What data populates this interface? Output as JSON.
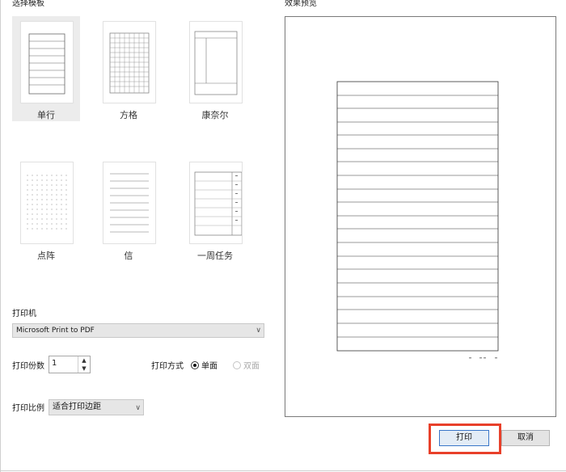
{
  "templates_section": {
    "label": "选择模板"
  },
  "preview_section": {
    "label": "效果预览"
  },
  "templates": [
    {
      "label": "单行",
      "icon": "single-line-icon",
      "selected": true
    },
    {
      "label": "方格",
      "icon": "grid-icon",
      "selected": false
    },
    {
      "label": "康奈尔",
      "icon": "cornell-icon",
      "selected": false
    },
    {
      "label": "点阵",
      "icon": "dot-grid-icon",
      "selected": false
    },
    {
      "label": "信",
      "icon": "letter-lines-icon",
      "selected": false
    },
    {
      "label": "一周任务",
      "icon": "weekly-tasks-icon",
      "selected": false
    }
  ],
  "printer": {
    "label": "打印机",
    "selected": "Microsoft Print to PDF"
  },
  "copies": {
    "label": "打印份数",
    "value": "1"
  },
  "print_mode": {
    "label": "打印方式",
    "options": [
      "单面",
      "双面"
    ],
    "selected": "单面"
  },
  "scale": {
    "label": "打印比例",
    "selected": "适合打印边距"
  },
  "buttons": {
    "print": "打印",
    "cancel": "取消"
  },
  "colors": {
    "highlight": "#e8402a",
    "print_button_border": "#3a76c8",
    "selected_tile": "#ececec"
  }
}
